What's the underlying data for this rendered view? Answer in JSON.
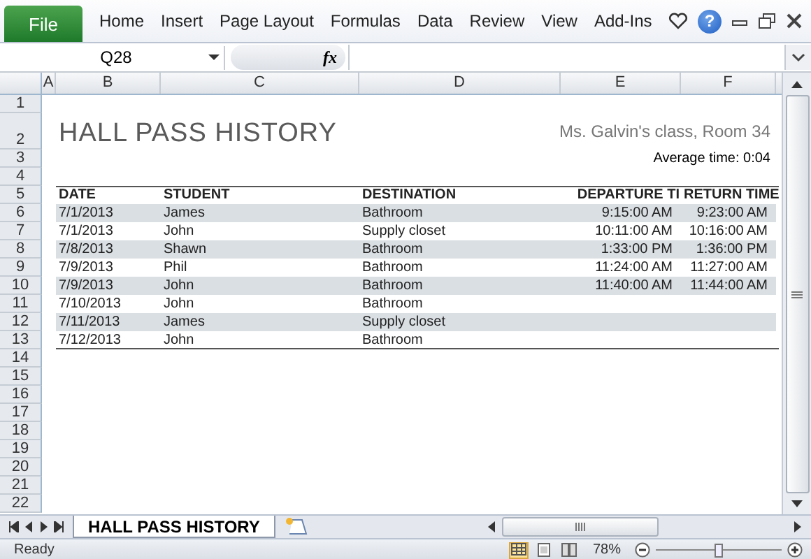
{
  "ribbon": {
    "file": "File",
    "tabs": [
      {
        "label": "Home",
        "selected": false
      },
      {
        "label": "Insert",
        "selected": false
      },
      {
        "label": "Page Layout",
        "selected": false
      },
      {
        "label": "Formulas",
        "selected": false
      },
      {
        "label": "Data",
        "selected": false
      },
      {
        "label": "Review",
        "selected": false
      },
      {
        "label": "View",
        "selected": false
      },
      {
        "label": "Add-Ins",
        "selected": false
      }
    ],
    "help": "?"
  },
  "formula_bar": {
    "name_box": "Q28",
    "function_label": "fx"
  },
  "columns": [
    "A",
    "B",
    "C",
    "D",
    "E",
    "F"
  ],
  "row_numbers": [
    "1",
    "2",
    "3",
    "4",
    "5",
    "6",
    "7",
    "8",
    "9",
    "10",
    "11",
    "12",
    "13",
    "14",
    "15",
    "16",
    "17",
    "18",
    "19",
    "20",
    "21",
    "22"
  ],
  "sheet": {
    "title": "HALL PASS HISTORY",
    "subtitle": "Ms. Galvin's class, Room 34",
    "average": "Average time: 0:04",
    "headers": [
      "DATE",
      "STUDENT",
      "DESTINATION",
      "DEPARTURE TI",
      "RETURN TIME"
    ],
    "rows": [
      {
        "date": "7/1/2013",
        "student": "James",
        "destination": "Bathroom",
        "departure": "9:15:00 AM",
        "return": "9:23:00 AM"
      },
      {
        "date": "7/1/2013",
        "student": "John",
        "destination": "Supply closet",
        "departure": "10:11:00 AM",
        "return": "10:16:00 AM"
      },
      {
        "date": "7/8/2013",
        "student": "Shawn",
        "destination": "Bathroom",
        "departure": "1:33:00 PM",
        "return": "1:36:00 PM"
      },
      {
        "date": "7/9/2013",
        "student": "Phil",
        "destination": "Bathroom",
        "departure": "11:24:00 AM",
        "return": "11:27:00 AM"
      },
      {
        "date": "7/9/2013",
        "student": "John",
        "destination": "Bathroom",
        "departure": "11:40:00 AM",
        "return": "11:44:00 AM"
      },
      {
        "date": "7/10/2013",
        "student": "John",
        "destination": "Bathroom"
      },
      {
        "date": "7/11/2013",
        "student": "James",
        "destination": "Supply closet"
      },
      {
        "date": "7/12/2013",
        "student": "John",
        "destination": "Bathroom"
      }
    ]
  },
  "sheet_tabs": [
    {
      "label": "HALL PASS HISTORY",
      "selected": true
    }
  ],
  "status_bar": {
    "status": "Ready",
    "views": [
      {
        "kind": "normal",
        "selected": true
      },
      {
        "kind": "layout",
        "selected": false
      },
      {
        "kind": "break",
        "selected": false
      }
    ],
    "zoom": "78%",
    "zoom_slider": {
      "level": 0.5
    }
  }
}
